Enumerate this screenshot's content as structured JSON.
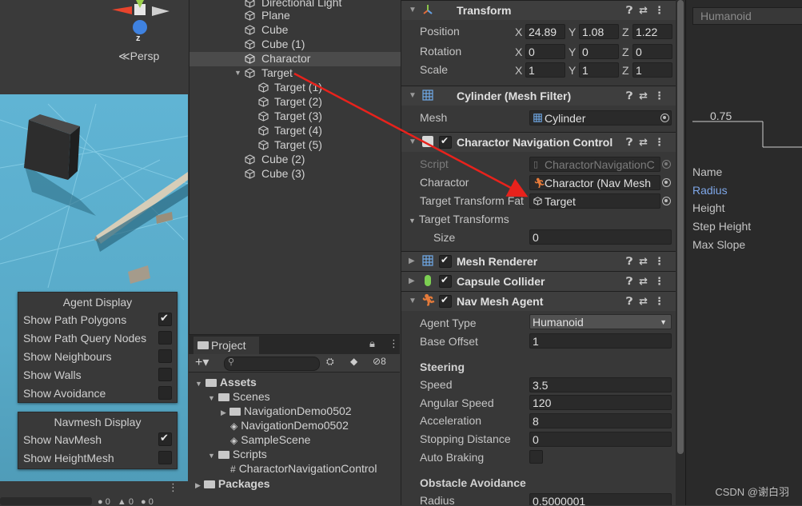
{
  "scene": {
    "gizmo_axis": "z",
    "persp_label": "≪Persp",
    "status_counts": [
      "0",
      "0",
      "0"
    ],
    "agent_display": {
      "title": "Agent Display",
      "items": [
        {
          "label": "Show Path Polygons",
          "checked": true
        },
        {
          "label": "Show Path Query Nodes",
          "checked": false
        },
        {
          "label": "Show Neighbours",
          "checked": false
        },
        {
          "label": "Show Walls",
          "checked": false
        },
        {
          "label": "Show Avoidance",
          "checked": false
        }
      ]
    },
    "navmesh_display": {
      "title": "Navmesh Display",
      "items": [
        {
          "label": "Show NavMesh",
          "checked": true
        },
        {
          "label": "Show HeightMesh",
          "checked": false
        }
      ]
    }
  },
  "hierarchy": {
    "items": [
      {
        "label": "Directional Light",
        "indent": 0
      },
      {
        "label": "Plane",
        "indent": 0
      },
      {
        "label": "Cube",
        "indent": 0
      },
      {
        "label": "Cube (1)",
        "indent": 0
      },
      {
        "label": "Charactor",
        "indent": 0,
        "selected": true
      },
      {
        "label": "Target",
        "indent": 0,
        "expanded": true
      },
      {
        "label": "Target (1)",
        "indent": 1
      },
      {
        "label": "Target (2)",
        "indent": 1
      },
      {
        "label": "Target (3)",
        "indent": 1
      },
      {
        "label": "Target (4)",
        "indent": 1
      },
      {
        "label": "Target (5)",
        "indent": 1
      },
      {
        "label": "Cube (2)",
        "indent": 0
      },
      {
        "label": "Cube (3)",
        "indent": 0
      }
    ]
  },
  "project": {
    "tab_label": "Project",
    "hidden_count": "8",
    "tree": [
      {
        "label": "Assets",
        "indent": 0,
        "bold": true,
        "type": "folder"
      },
      {
        "label": "Scenes",
        "indent": 1,
        "type": "folder"
      },
      {
        "label": "NavigationDemo0502",
        "indent": 2,
        "type": "folder"
      },
      {
        "label": "NavigationDemo0502",
        "indent": 2,
        "type": "scene"
      },
      {
        "label": "SampleScene",
        "indent": 2,
        "type": "scene"
      },
      {
        "label": "Scripts",
        "indent": 1,
        "type": "folder"
      },
      {
        "label": "CharactorNavigationControl",
        "indent": 2,
        "type": "script"
      },
      {
        "label": "Packages",
        "indent": 0,
        "bold": true,
        "type": "folder"
      }
    ]
  },
  "inspector": {
    "transform": {
      "title": "Transform",
      "position": {
        "label": "Position",
        "x": "24.89",
        "y": "1.08",
        "z": "1.22"
      },
      "rotation": {
        "label": "Rotation",
        "x": "0",
        "y": "0",
        "z": "0"
      },
      "scale": {
        "label": "Scale",
        "x": "1",
        "y": "1",
        "z": "1"
      }
    },
    "mesh_filter": {
      "title": "Cylinder (Mesh Filter)",
      "mesh_label": "Mesh",
      "mesh_value": "Cylinder"
    },
    "nav_control": {
      "title": "Charactor Navigation Control",
      "script_label": "Script",
      "script_value": "CharactorNavigationC",
      "charactor_label": "Charactor",
      "charactor_value": "Charactor (Nav Mesh",
      "target_transform_father_label": "Target Transform Fat",
      "target_transform_father_value": "Target",
      "target_transforms_label": "Target Transforms",
      "size_label": "Size",
      "size_value": "0"
    },
    "mesh_renderer": {
      "title": "Mesh Renderer"
    },
    "capsule_collider": {
      "title": "Capsule Collider"
    },
    "nav_mesh_agent": {
      "title": "Nav Mesh Agent",
      "agent_type_label": "Agent Type",
      "agent_type_value": "Humanoid",
      "base_offset_label": "Base Offset",
      "base_offset_value": "1",
      "steering_title": "Steering",
      "speed_label": "Speed",
      "speed_value": "3.5",
      "angular_speed_label": "Angular Speed",
      "angular_speed_value": "120",
      "acceleration_label": "Acceleration",
      "acceleration_value": "8",
      "stopping_distance_label": "Stopping Distance",
      "stopping_distance_value": "0",
      "auto_braking_label": "Auto Braking",
      "obstacle_title": "Obstacle Avoidance",
      "radius_label": "Radius",
      "radius_value": "0.5000001"
    }
  },
  "navpanel": {
    "agent_type_value": "Humanoid",
    "graph_label": "0.75",
    "fields": [
      {
        "label": "Name",
        "highlight": false
      },
      {
        "label": "Radius",
        "highlight": true
      },
      {
        "label": "Height",
        "highlight": false
      },
      {
        "label": "Step Height",
        "highlight": false
      },
      {
        "label": "Max Slope",
        "highlight": false
      }
    ]
  },
  "watermark": "CSDN @谢白羽",
  "colors": {
    "accent_blue": "#7ea7e8",
    "arrow_red": "#e8221c",
    "selection": "#4b4b4b"
  }
}
